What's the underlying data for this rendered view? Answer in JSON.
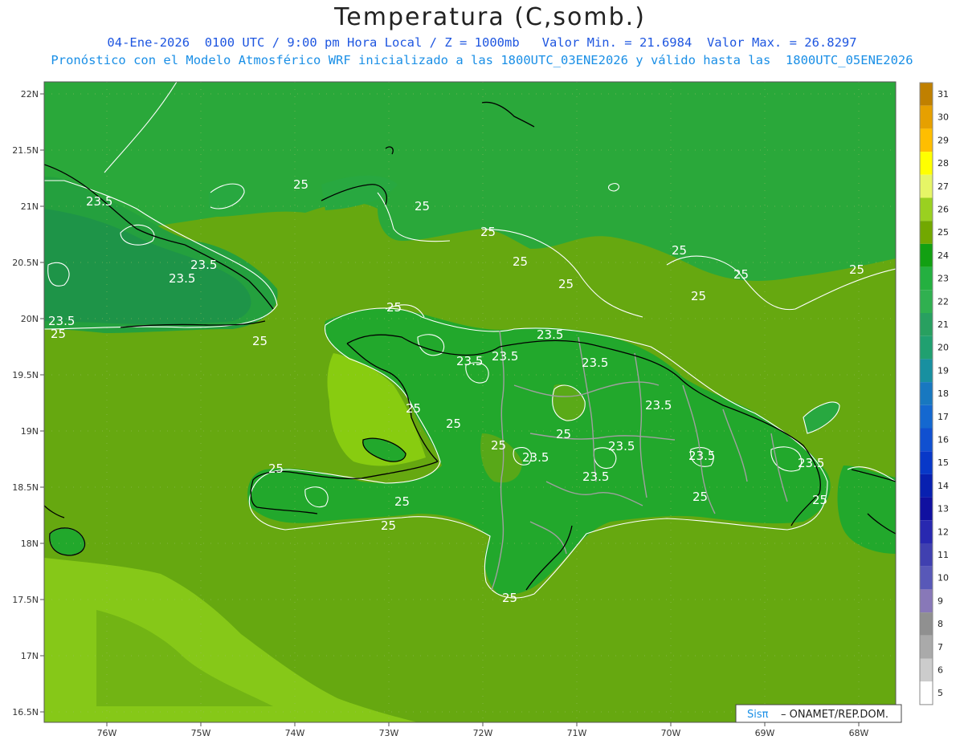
{
  "header": {
    "title": "Temperatura (C,somb.)",
    "line1": "04-Ene-2026  0100 UTC / 9:00 pm Hora Local / Z = 1000mb   Valor Min. = 21.6984  Valor Max. = 26.8297",
    "line2": "Pronóstico con el Modelo Atmosférico WRF inicializado a las 1800UTC_03ENE2026 y válido hasta las  1800UTC_05ENE2026"
  },
  "axes": {
    "lat_labels": [
      "22N",
      "21.5N",
      "21N",
      "20.5N",
      "20N",
      "19.5N",
      "19N",
      "18.5N",
      "18N",
      "17.5N",
      "17N",
      "16.5N"
    ],
    "lon_labels": [
      "76W",
      "75W",
      "74W",
      "73W",
      "72W",
      "71W",
      "70W",
      "69W",
      "68W"
    ]
  },
  "colorbar": {
    "levels": [
      "31",
      "30",
      "29",
      "28",
      "27",
      "26",
      "25",
      "24",
      "23",
      "22",
      "21",
      "20",
      "19",
      "18",
      "17",
      "16",
      "15",
      "14",
      "13",
      "12",
      "11",
      "10",
      "9",
      "8",
      "7",
      "6",
      "5"
    ],
    "colors": [
      "#c08000",
      "#e6a000",
      "#ffbe00",
      "#ffff00",
      "#e6f566",
      "#9ad020",
      "#72a800",
      "#12a012",
      "#24b040",
      "#30b050",
      "#28a060",
      "#20a070",
      "#1890a0",
      "#1878c0",
      "#1468d0",
      "#1050d0",
      "#0838c8",
      "#0820b0",
      "#1010a0",
      "#2828b0",
      "#4040b0",
      "#5858b8",
      "#8878b8",
      "#909090",
      "#aaaaaa",
      "#cccccc",
      "#ffffff"
    ]
  },
  "contour_labels": [
    "23.5",
    "25"
  ],
  "credit": {
    "brand": "Sisπ",
    "text": "– ONAMET/REP.DOM."
  },
  "colors": {
    "sea": "#66a810",
    "land_warm": "#52a80a",
    "land": "#24a82a",
    "land_cool": "#1e9e3c",
    "south_sea": "#86c818",
    "coast": "#000000",
    "border": "#a0a0a0",
    "contour": "#ffffff"
  }
}
